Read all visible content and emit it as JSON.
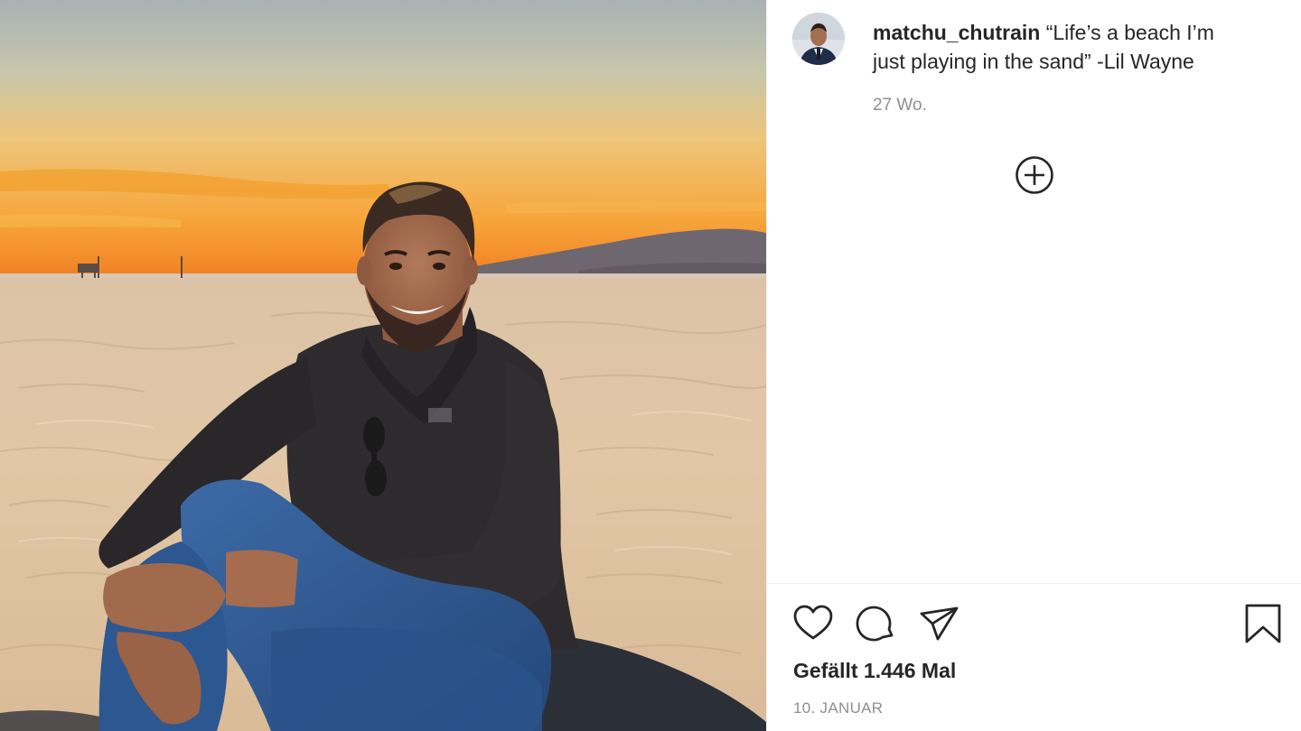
{
  "post": {
    "username": "matchu_chutrain",
    "caption": "“Life’s a beach I’m just playing in the sand” -Lil Wayne",
    "time_ago": "27 Wo.",
    "likes_text": "Gefällt 1.446 Mal",
    "date": "10. JANUAR"
  },
  "icons": {
    "load_more": "plus-circle-icon",
    "like": "heart-icon",
    "comment": "comment-icon",
    "share": "paper-plane-icon",
    "save": "bookmark-icon"
  },
  "colors": {
    "text": "#262626",
    "secondary_text": "#8e8e8e",
    "divider": "#efefef"
  }
}
